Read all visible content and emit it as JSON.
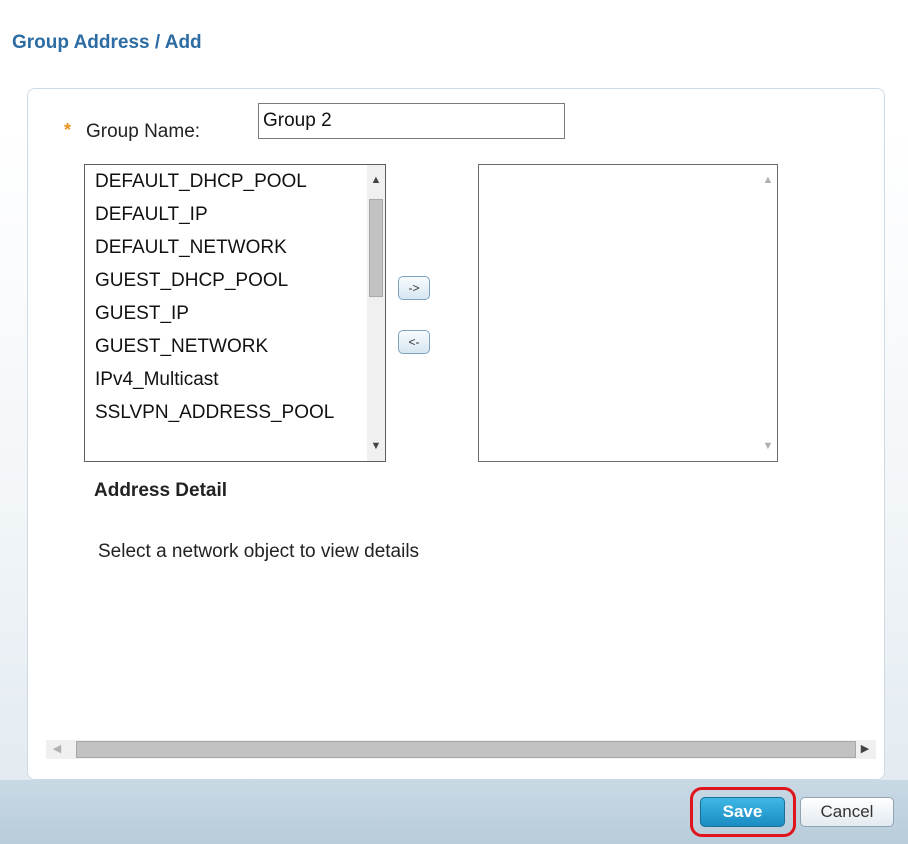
{
  "page": {
    "title": "Group Address / Add"
  },
  "form": {
    "required_marker": "*",
    "group_name_label": "Group Name:",
    "group_name_value": "Group 2"
  },
  "available_list": {
    "items": [
      "DEFAULT_DHCP_POOL",
      "DEFAULT_IP",
      "DEFAULT_NETWORK",
      "GUEST_DHCP_POOL",
      "GUEST_IP",
      "GUEST_NETWORK",
      "IPv4_Multicast",
      "SSLVPN_ADDRESS_POOL"
    ]
  },
  "selected_list": {
    "items": []
  },
  "move_buttons": {
    "add_label": "->",
    "remove_label": "<-"
  },
  "address_detail": {
    "title": "Address Detail",
    "hint": "Select a network object to view details"
  },
  "footer": {
    "save_label": "Save",
    "cancel_label": "Cancel"
  },
  "colors": {
    "title": "#2c6ca3",
    "save": "#1a8cc3",
    "highlight": "#e0141d",
    "required": "#e8921b"
  }
}
